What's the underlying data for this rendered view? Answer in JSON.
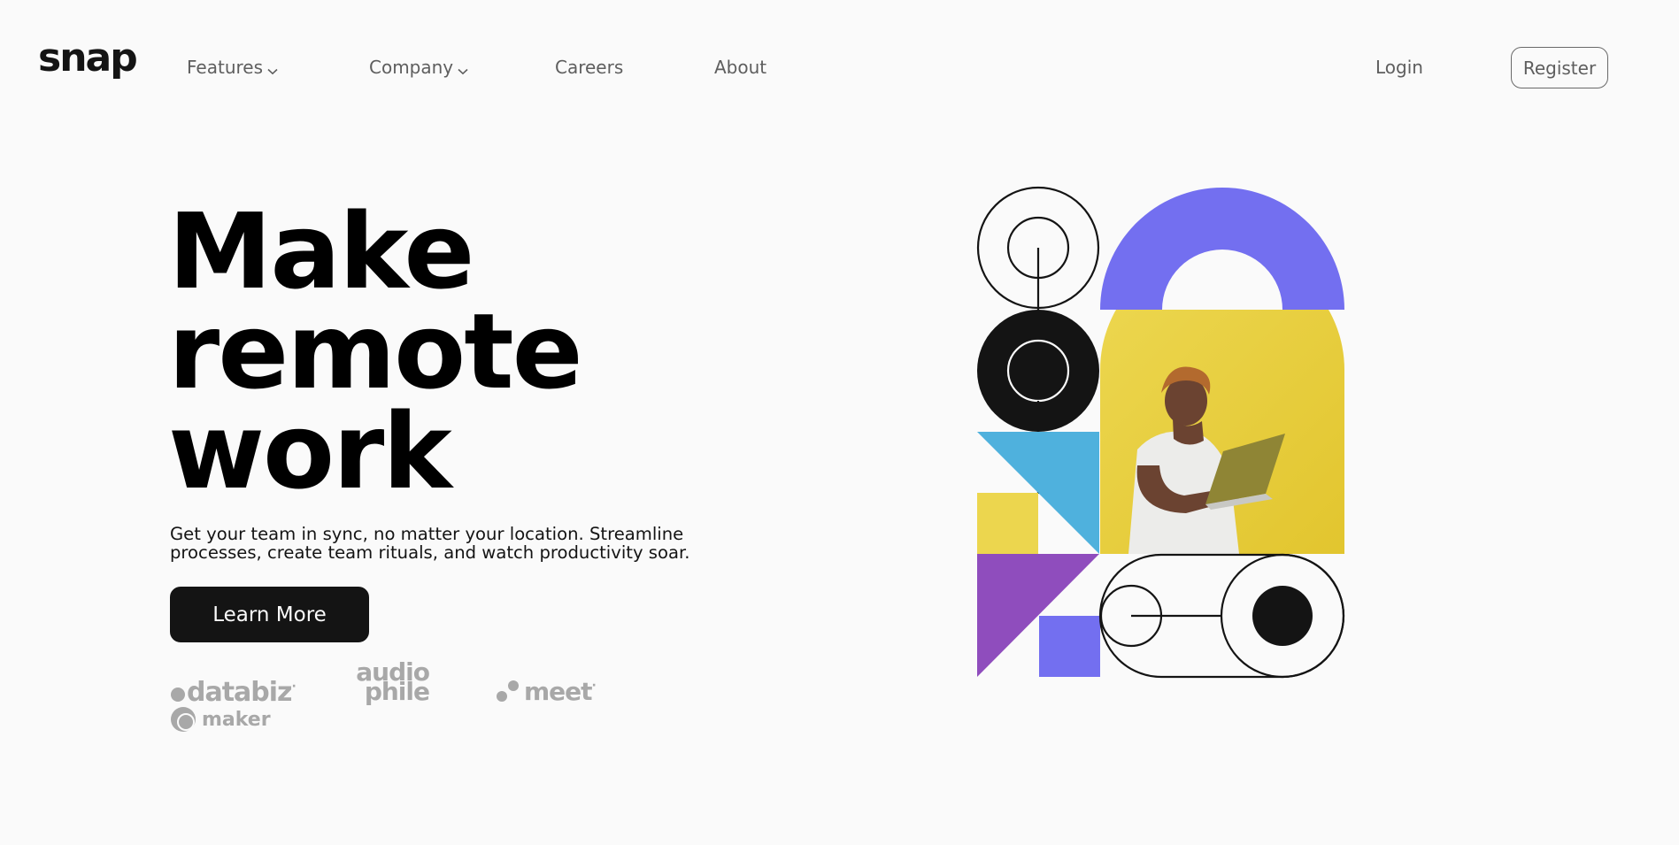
{
  "brand": {
    "logo": "snap"
  },
  "nav": {
    "items": [
      {
        "label": "Features",
        "has_dropdown": true
      },
      {
        "label": "Company",
        "has_dropdown": true
      },
      {
        "label": "Careers",
        "has_dropdown": false
      },
      {
        "label": "About",
        "has_dropdown": false
      }
    ],
    "login": "Login",
    "register": "Register"
  },
  "hero": {
    "headline": [
      "Make",
      "remote",
      "work"
    ],
    "description": "Get your team in sync, no matter your location. Streamline processes, create team rituals, and watch productivity soar.",
    "cta": "Learn More",
    "clients": {
      "databiz": "databiz",
      "audiophile_line1": "audio",
      "audiophile_line2": "phile",
      "meet": "meet",
      "maker": "maker"
    }
  },
  "colors": {
    "background": "#fafafa",
    "text": "#141414",
    "muted": "#5e5e5e",
    "logo_gray": "#a8a8a8",
    "purple": "#736ff0",
    "yellow": "#ecd64e",
    "blue": "#4fb1dd",
    "violet": "#8f4dbd"
  },
  "icons": [
    "chevron-down-icon",
    "chevron-down-icon"
  ]
}
